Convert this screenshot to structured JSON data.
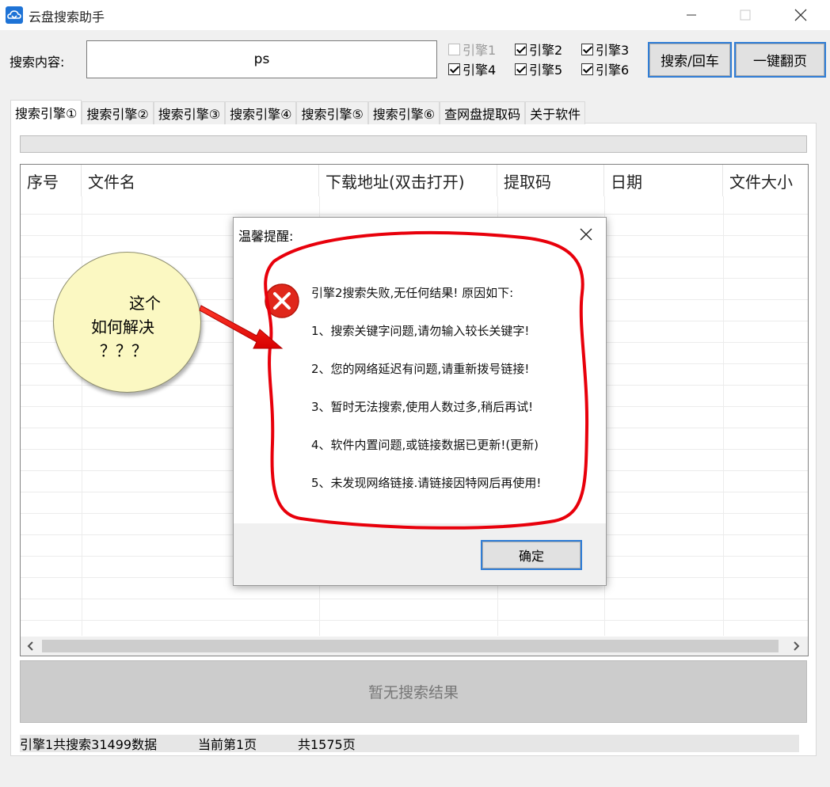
{
  "window": {
    "title": "云盘搜索助手"
  },
  "search": {
    "label": "搜索内容:",
    "value": "ps"
  },
  "engines": [
    {
      "label": "引擎1",
      "checked": false,
      "enabled": false
    },
    {
      "label": "引擎2",
      "checked": true,
      "enabled": true
    },
    {
      "label": "引擎3",
      "checked": true,
      "enabled": true
    },
    {
      "label": "引擎4",
      "checked": true,
      "enabled": true
    },
    {
      "label": "引擎5",
      "checked": true,
      "enabled": true
    },
    {
      "label": "引擎6",
      "checked": true,
      "enabled": true
    }
  ],
  "buttons": {
    "search": "搜索/回车",
    "next_page": "一键翻页",
    "ok": "确定"
  },
  "tabs": [
    "搜索引擎①",
    "搜索引擎②",
    "搜索引擎③",
    "搜索引擎④",
    "搜索引擎⑤",
    "搜索引擎⑥",
    "查网盘提取码",
    "关于软件"
  ],
  "table": {
    "columns": [
      "序号",
      "文件名",
      "下载地址(双击打开)",
      "提取码",
      "日期",
      "文件大小"
    ]
  },
  "empty_result": "暂无搜索结果",
  "status": {
    "total": "引擎1共搜索31499数据",
    "current_page": "当前第1页",
    "page_count": "共1575页"
  },
  "dialog": {
    "title": "温馨提醒:",
    "lines": [
      "引擎2搜索失败,无任何结果!  原因如下:",
      "1、搜索关键字问题,请勿输入较长关键字!",
      "2、您的网络延迟有问题,请重新拨号链接!",
      "3、暂时无法搜索,使用人数过多,稍后再试!",
      "4、软件内置问题,或链接数据已更新!(更新)",
      "5、未发现网络链接.请链接因特网后再使用!"
    ]
  },
  "annotation": {
    "line1": "这个",
    "line2": "如何解决",
    "line3": "？？？"
  },
  "colors": {
    "accent_border": "#2f7dd6",
    "error_icon": "#e0271b",
    "annotation_red": "#e8000b",
    "bubble": "#fbf8c2"
  }
}
